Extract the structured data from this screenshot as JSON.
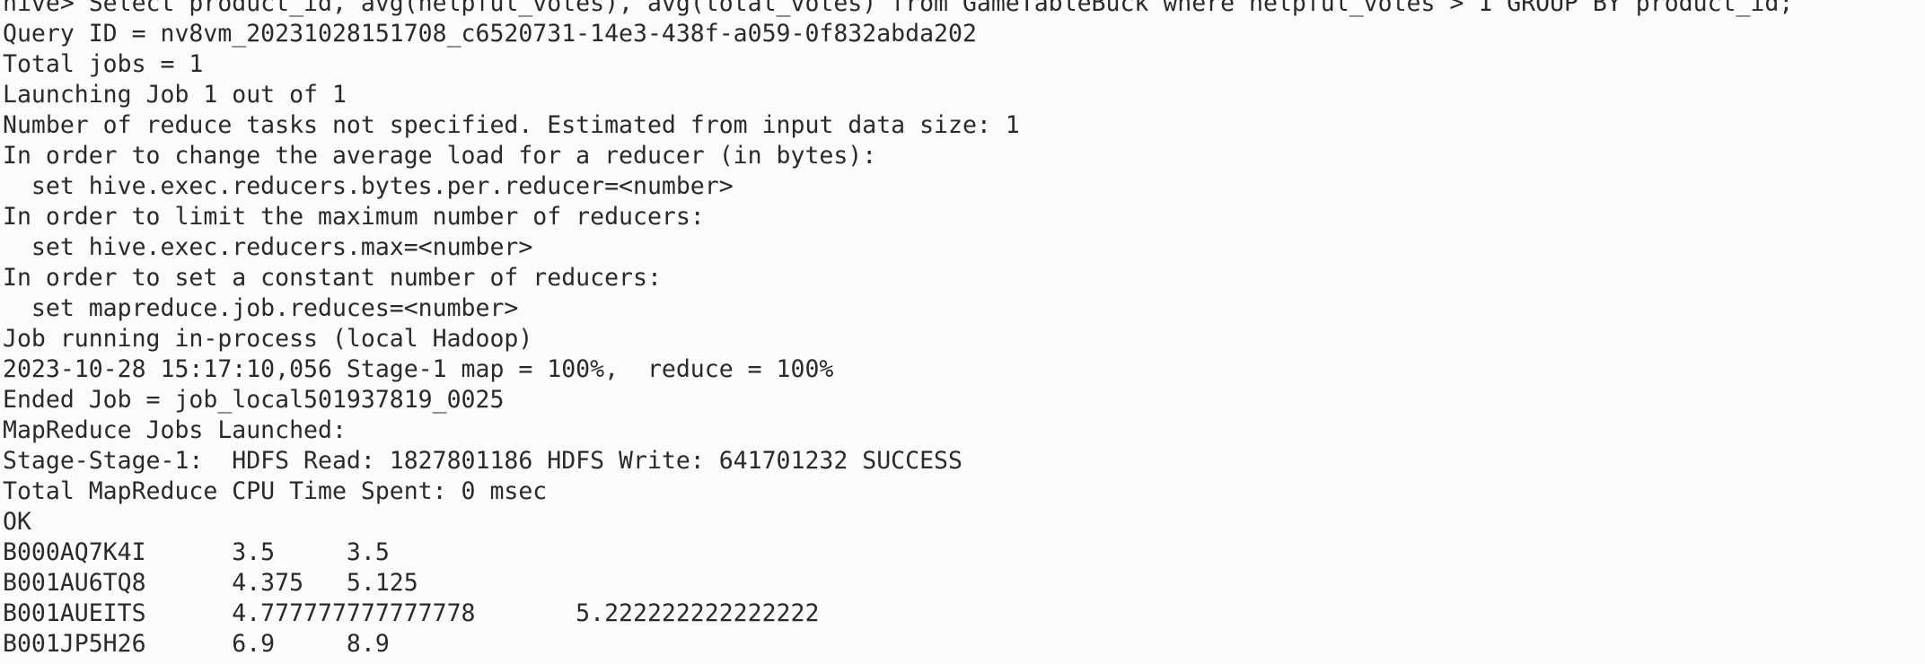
{
  "terminal": {
    "lines": [
      "hive> Select product_id, avg(helpful_votes), avg(total_votes) from GameTableBuck where helpful_votes > 1 GROUP BY product_id;",
      "Query ID = nv8vm_20231028151708_c6520731-14e3-438f-a059-0f832abda202",
      "Total jobs = 1",
      "Launching Job 1 out of 1",
      "Number of reduce tasks not specified. Estimated from input data size: 1",
      "In order to change the average load for a reducer (in bytes):",
      "  set hive.exec.reducers.bytes.per.reducer=<number>",
      "In order to limit the maximum number of reducers:",
      "  set hive.exec.reducers.max=<number>",
      "In order to set a constant number of reducers:",
      "  set mapreduce.job.reduces=<number>",
      "Job running in-process (local Hadoop)",
      "2023-10-28 15:17:10,056 Stage-1 map = 100%,  reduce = 100%",
      "Ended Job = job_local501937819_0025",
      "MapReduce Jobs Launched:",
      "Stage-Stage-1:  HDFS Read: 1827801186 HDFS Write: 641701232 SUCCESS",
      "Total MapReduce CPU Time Spent: 0 msec",
      "OK",
      "B000AQ7K4I      3.5     3.5",
      "B001AU6TQ8      4.375   5.125",
      "B001AUEITS      4.777777777777778       5.222222222222222",
      "B001JP5H26      6.9     8.9"
    ]
  }
}
